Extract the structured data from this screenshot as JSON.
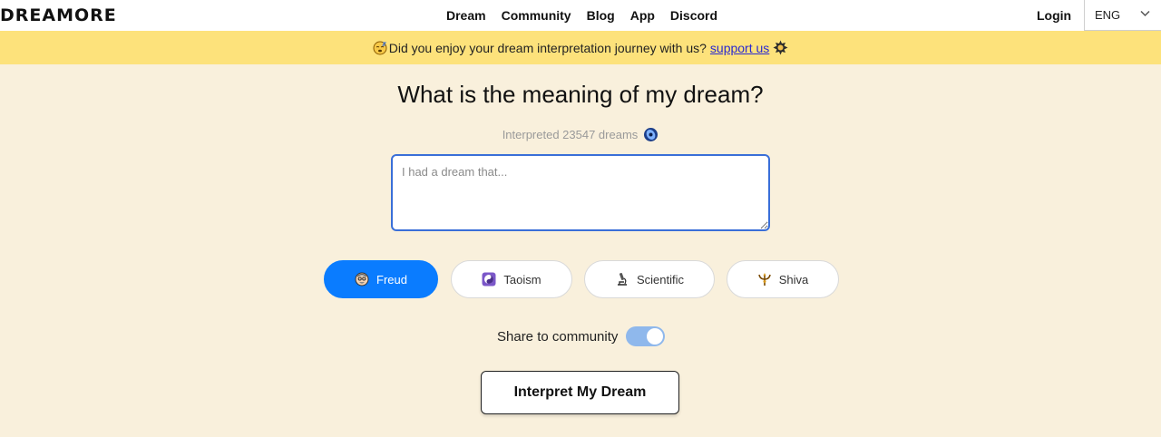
{
  "header": {
    "logo": "DREAMORE",
    "nav": [
      "Dream",
      "Community",
      "Blog",
      "App",
      "Discord"
    ],
    "login": "Login",
    "language": "ENG"
  },
  "banner": {
    "left_icon": "dreaming-face-emoji",
    "text": "Did you enjoy your dream interpretation journey with us?",
    "link": "support us",
    "right_icon": "gem-star-emoji",
    "color": "#fde27b"
  },
  "main": {
    "title": "What is the meaning of my dream?",
    "counter": "Interpreted 23547 dreams",
    "counter_icon": "crystal-eye-icon",
    "input_placeholder": "I had a dream that...",
    "input_value": ""
  },
  "modes": [
    {
      "label": "Freud",
      "icon": "freud-face-icon",
      "active": true
    },
    {
      "label": "Taoism",
      "icon": "yin-yang-icon",
      "active": false
    },
    {
      "label": "Scientific",
      "icon": "microscope-icon",
      "active": false
    },
    {
      "label": "Shiva",
      "icon": "trident-icon",
      "active": false
    }
  ],
  "share": {
    "label": "Share to community",
    "enabled": true
  },
  "action": {
    "label": "Interpret My Dream"
  },
  "colors": {
    "background": "#f9f0dc",
    "accent": "#0a7cff",
    "toggle_on": "#8fb8ec"
  }
}
